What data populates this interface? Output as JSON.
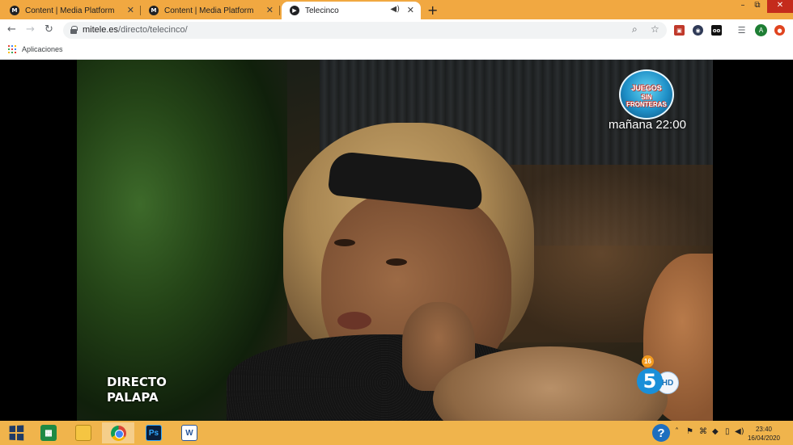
{
  "browser": {
    "tabs": [
      {
        "title": "Content | Media Platform",
        "favicon": "M",
        "active": false
      },
      {
        "title": "Content | Media Platform",
        "favicon": "M",
        "active": false
      },
      {
        "title": "Telecinco",
        "favicon": "▶",
        "active": true
      }
    ],
    "new_tab_icon": "+",
    "window_controls": {
      "minimize": "–",
      "maximize": "⧉",
      "close": "✕"
    },
    "nav": {
      "back": "←",
      "forward": "→",
      "reload": "↻"
    },
    "address": {
      "host": "mitele.es",
      "path": "/directo/telecinco/"
    },
    "omnibox_icons": {
      "zoom": "⌕",
      "bookmark": "☆"
    },
    "extensions": [
      "shield-ext",
      "vpn-ext",
      "oo-ext"
    ],
    "profile_initial": "A",
    "bookmarks": {
      "apps_label": "Aplicaciones"
    }
  },
  "video": {
    "promo": {
      "logo_line1": "JUEGOS",
      "logo_line2": "SIN FRONTERAS",
      "time": "mañana 22:00"
    },
    "live_label": {
      "line1": "DIRECTO",
      "line2": "PALAPA"
    },
    "rating": "16",
    "channel_number": "5",
    "channel_hd": "HD"
  },
  "taskbar": {
    "apps": [
      "windows-start",
      "calculator",
      "file-explorer",
      "chrome",
      "photoshop",
      "word"
    ],
    "photoshop_label": "Ps",
    "word_label": "W",
    "help_symbol": "?",
    "clock": {
      "time": "23:40",
      "date": "16/04/2020"
    }
  },
  "colors": {
    "chrome_frame": "#f1a841",
    "taskbar": "#f0b44c",
    "channel_blue": "#1a8fd8",
    "rating_orange": "#f29a1f"
  }
}
